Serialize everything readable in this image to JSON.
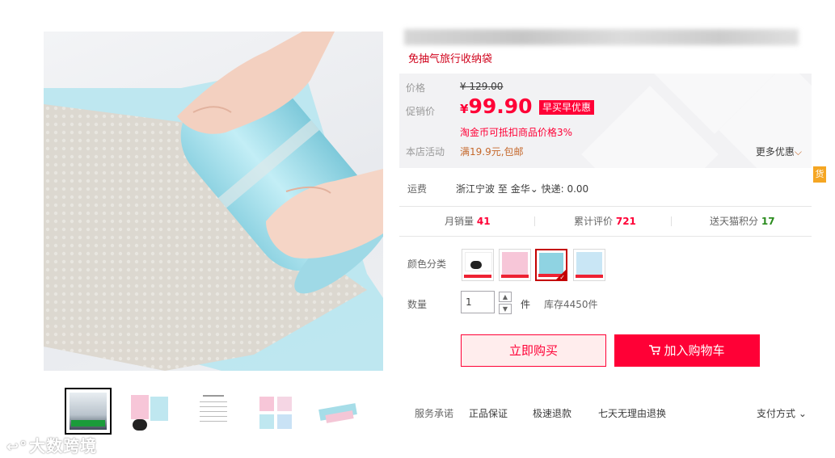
{
  "product": {
    "subtitle": "免抽气旅行收纳袋"
  },
  "price_panel": {
    "price_label": "价格",
    "original_price": "¥ 129.00",
    "promo_label": "促销价",
    "promo_currency": "¥",
    "promo_value": "99.90",
    "promo_badge": "早买早优惠",
    "coin_note": "淘金币可抵扣商品价格3%",
    "shop_activity_label": "本店活动",
    "shop_activity_value": "满19.9元,包邮",
    "more_offers": "更多优惠"
  },
  "side_tab": "货",
  "shipping": {
    "label": "运费",
    "origin": "浙江宁波",
    "to_word": "至",
    "destination": "金华",
    "express": "快递: 0.00"
  },
  "stats": {
    "monthly_sales_label": "月销量",
    "monthly_sales_value": "41",
    "reviews_label": "累计评价",
    "reviews_value": "721",
    "points_label": "送天猫积分",
    "points_value": "17"
  },
  "color": {
    "label": "颜色分类",
    "selected_index": 2
  },
  "quantity": {
    "label": "数量",
    "value": "1",
    "unit": "件",
    "stock": "库存4450件"
  },
  "actions": {
    "buy_now": "立即购买",
    "add_to_cart": "加入购物车"
  },
  "service": {
    "label": "服务承诺",
    "items": [
      "正品保证",
      "极速退款",
      "七天无理由退换"
    ],
    "payment": "支付方式"
  },
  "watermark": "大数跨境",
  "colors": {
    "accent": "#ff0036",
    "subtitle": "#d0021b",
    "green": "#2b8c1e",
    "orange": "#c5682b",
    "product_blue": "#a6dde8"
  }
}
